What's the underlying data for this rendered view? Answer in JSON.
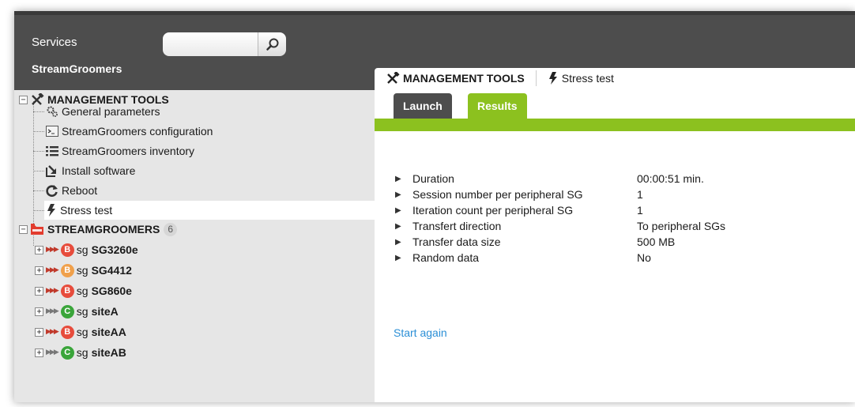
{
  "topbar": {
    "services_label": "Services",
    "search": {
      "value": "",
      "placeholder": "",
      "icon": "search-icon"
    }
  },
  "left": {
    "title": "StreamGroomers",
    "management": {
      "label": "MANAGEMENT TOOLS",
      "items": [
        {
          "label": "General parameters",
          "icon": "gears-icon"
        },
        {
          "label": "StreamGroomers configuration",
          "icon": "terminal-icon"
        },
        {
          "label": "StreamGroomers inventory",
          "icon": "list-icon"
        },
        {
          "label": "Install software",
          "icon": "install-icon"
        },
        {
          "label": "Reboot",
          "icon": "reboot-icon"
        },
        {
          "label": "Stress test",
          "icon": "lightning-icon"
        }
      ]
    },
    "groomers": {
      "label": "STREAMGROOMERS",
      "count": "6",
      "items": [
        {
          "prefix": "sg",
          "name": "SG3260e",
          "status": "B",
          "status_color": "#e74c3c",
          "arrow_color": "red"
        },
        {
          "prefix": "sg",
          "name": "SG4412",
          "status": "B",
          "status_color": "#f0a04b",
          "arrow_color": "red"
        },
        {
          "prefix": "sg",
          "name": "SG860e",
          "status": "B",
          "status_color": "#e74c3c",
          "arrow_color": "red"
        },
        {
          "prefix": "sg",
          "name": "siteA",
          "status": "C",
          "status_color": "#3aa53a",
          "arrow_color": "gray"
        },
        {
          "prefix": "sg",
          "name": "siteAA",
          "status": "B",
          "status_color": "#e74c3c",
          "arrow_color": "red"
        },
        {
          "prefix": "sg",
          "name": "siteAB",
          "status": "C",
          "status_color": "#3aa53a",
          "arrow_color": "gray"
        }
      ]
    }
  },
  "right": {
    "breadcrumb": {
      "section": "MANAGEMENT TOOLS",
      "page": "Stress test"
    },
    "tabs": [
      {
        "label": "Launch",
        "active": false
      },
      {
        "label": "Results",
        "active": true
      }
    ],
    "details": [
      {
        "label": "Duration",
        "value": "00:00:51 min."
      },
      {
        "label": "Session number per peripheral SG",
        "value": "1"
      },
      {
        "label": "Iteration count per peripheral SG",
        "value": "1"
      },
      {
        "label": "Transfert direction",
        "value": "To peripheral SGs"
      },
      {
        "label": "Transfer data size",
        "value": "500 MB"
      },
      {
        "label": "Random data",
        "value": "No"
      }
    ],
    "start_again": "Start again"
  },
  "colors": {
    "dark": "#4d4d4d",
    "accent_green": "#8cc11f",
    "link_blue": "#2b8fd6",
    "panel_gray": "#e6e6e6"
  }
}
